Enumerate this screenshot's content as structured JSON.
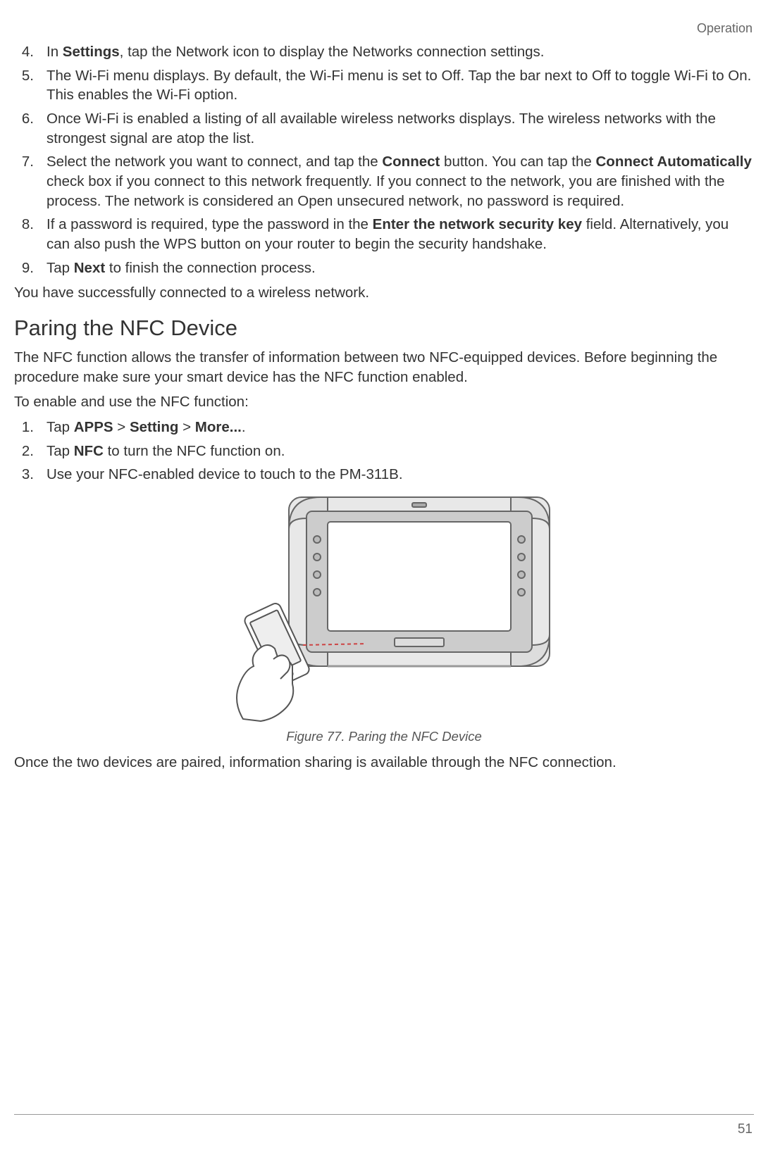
{
  "header": {
    "section_label": "Operation"
  },
  "wifi_steps": [
    {
      "num": "4.",
      "parts": [
        "In ",
        {
          "b": "Settings"
        },
        ", tap the Network icon to display the Networks connection settings."
      ]
    },
    {
      "num": "5.",
      "parts": [
        "The Wi-Fi menu displays. By default, the Wi-Fi menu is set to Off. Tap the bar next to Off to toggle Wi-Fi to On. This enables the Wi-Fi option."
      ]
    },
    {
      "num": "6.",
      "parts": [
        "Once Wi-Fi is enabled a listing of all available wireless networks displays. The wireless networks with the strongest signal are atop the list."
      ]
    },
    {
      "num": "7.",
      "parts": [
        "Select the network you want to connect, and tap the ",
        {
          "b": "Connect"
        },
        " button. You can tap the ",
        {
          "b": "Connect Automatically"
        },
        " check box if you connect to this network frequently. If you connect to the network, you are finished with the process. The network is considered an Open unsecured network, no password is required."
      ]
    },
    {
      "num": "8.",
      "parts": [
        "If a password is required, type the password in the ",
        {
          "b": "Enter the network security key"
        },
        " field. Alternatively, you can also push the WPS button on your router to begin the security handshake."
      ]
    },
    {
      "num": "9.",
      "parts": [
        "Tap ",
        {
          "b": "Next"
        },
        " to finish the connection process."
      ]
    }
  ],
  "wifi_done": "You have successfully connected to a wireless network.",
  "nfc": {
    "heading": "Paring the NFC Device",
    "intro": "The NFC function allows the transfer of information between two NFC-equipped devices. Before beginning the procedure make sure your smart device has the NFC function enabled.",
    "lead": "To enable and use the NFC function:",
    "steps": [
      {
        "num": "1.",
        "parts": [
          "Tap ",
          {
            "b": "APPS"
          },
          " > ",
          {
            "b": "Setting"
          },
          " > ",
          {
            "b": "More..."
          },
          "."
        ]
      },
      {
        "num": "2.",
        "parts": [
          "Tap ",
          {
            "b": "NFC"
          },
          " to turn the NFC function on."
        ]
      },
      {
        "num": "3.",
        "parts": [
          "Use your NFC-enabled device to touch to the PM-311B."
        ]
      }
    ],
    "figure_caption": "Figure 77.  Paring the NFC Device",
    "outro": "Once the two devices are paired, information sharing is available through the NFC connection."
  },
  "page_number": "51"
}
